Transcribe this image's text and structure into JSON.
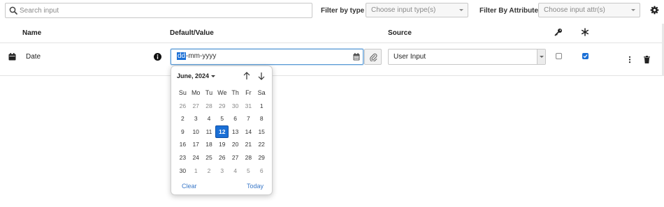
{
  "search": {
    "placeholder": "Search input"
  },
  "filters": {
    "type_label": "Filter by type",
    "type_placeholder": "Choose input type(s)",
    "attr_label": "Filter By Attribute",
    "attr_placeholder": "Choose input attr(s)"
  },
  "columns": {
    "name": "Name",
    "value": "Default/Value",
    "source": "Source"
  },
  "row": {
    "name": "Date",
    "date_selected_segment": "dd",
    "date_rest": "-mm-yyyy",
    "source": "User Input",
    "key_checked": false,
    "required_checked": true
  },
  "datepicker": {
    "month": "June, 2024",
    "weekdays": [
      "Su",
      "Mo",
      "Tu",
      "We",
      "Th",
      "Fr",
      "Sa"
    ],
    "weeks": [
      [
        {
          "d": "26",
          "o": true
        },
        {
          "d": "27",
          "o": true
        },
        {
          "d": "28",
          "o": true
        },
        {
          "d": "29",
          "o": true
        },
        {
          "d": "30",
          "o": true
        },
        {
          "d": "31",
          "o": true
        },
        {
          "d": "1",
          "o": false
        }
      ],
      [
        {
          "d": "2",
          "o": false
        },
        {
          "d": "3",
          "o": false
        },
        {
          "d": "4",
          "o": false
        },
        {
          "d": "5",
          "o": false
        },
        {
          "d": "6",
          "o": false
        },
        {
          "d": "7",
          "o": false
        },
        {
          "d": "8",
          "o": false
        }
      ],
      [
        {
          "d": "9",
          "o": false
        },
        {
          "d": "10",
          "o": false
        },
        {
          "d": "11",
          "o": false
        },
        {
          "d": "12",
          "o": false,
          "sel": true
        },
        {
          "d": "13",
          "o": false
        },
        {
          "d": "14",
          "o": false
        },
        {
          "d": "15",
          "o": false
        }
      ],
      [
        {
          "d": "16",
          "o": false
        },
        {
          "d": "17",
          "o": false
        },
        {
          "d": "18",
          "o": false
        },
        {
          "d": "19",
          "o": false
        },
        {
          "d": "20",
          "o": false
        },
        {
          "d": "21",
          "o": false
        },
        {
          "d": "22",
          "o": false
        }
      ],
      [
        {
          "d": "23",
          "o": false
        },
        {
          "d": "24",
          "o": false
        },
        {
          "d": "25",
          "o": false
        },
        {
          "d": "26",
          "o": false
        },
        {
          "d": "27",
          "o": false
        },
        {
          "d": "28",
          "o": false
        },
        {
          "d": "29",
          "o": false
        }
      ],
      [
        {
          "d": "30",
          "o": false
        },
        {
          "d": "1",
          "o": true
        },
        {
          "d": "2",
          "o": true
        },
        {
          "d": "3",
          "o": true
        },
        {
          "d": "4",
          "o": true
        },
        {
          "d": "5",
          "o": true
        },
        {
          "d": "6",
          "o": true
        }
      ]
    ],
    "clear_label": "Clear",
    "today_label": "Today"
  },
  "colors": {
    "accent": "#1a6fd6",
    "link": "#3a78c8",
    "border": "#c8c8c8"
  },
  "icons": {
    "search": "search-icon",
    "settings": "gear-icon",
    "key": "key-icon",
    "required": "asterisk-icon",
    "type": "calendar-icon",
    "info": "info-icon",
    "calendar": "calendar-icon",
    "attach": "paperclip-icon",
    "more": "more-vertical-icon",
    "delete": "trash-icon",
    "prev": "arrow-up-icon",
    "next": "arrow-down-icon"
  }
}
